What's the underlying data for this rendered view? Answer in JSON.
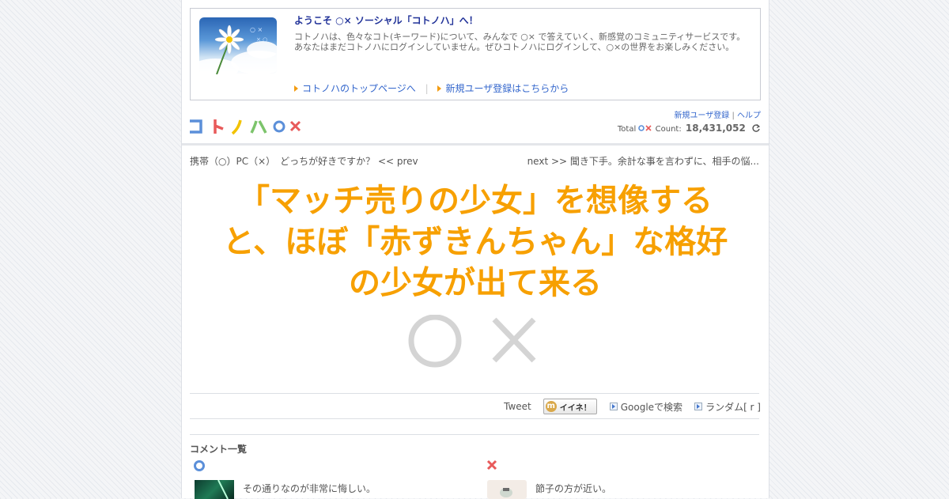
{
  "welcome": {
    "title": "ようこそ ○× ソーシャル「コトノハ」へ！",
    "desc_line1": "コトノハは、色々なコト(キーワード)について、みんなで ○× で答えていく、新感覚のコミュニティサービスです。",
    "desc_line2": "あなたはまだコトノハにログインしていません。ぜひコトノハにログインして、○×の世界をお楽しみください。",
    "link_top": "コトノハのトップページへ",
    "link_register": "新規ユーザ登録はこちらから"
  },
  "header": {
    "logo_letters": [
      "コ",
      "ト",
      "ノ",
      "ハ"
    ],
    "register_link": "新規ユーザ登録",
    "separator": "|",
    "help_link": "ヘルプ",
    "total_label": "Total",
    "count_label": "Count:",
    "count_value": "18,431,052"
  },
  "nav": {
    "prev": "携帯（○）PC（×）　どっちが好きですか？ << prev",
    "next": "next >> 聞き下手。余計な事を言わずに、相手の悩..."
  },
  "headline": {
    "line1": "「マッチ売りの少女」を想像する",
    "line2": "と、ほぼ「赤ずきんちゃん」な格好",
    "line3": "の少女が出て来る"
  },
  "share": {
    "tweet": "Tweet",
    "iine": "イイネ！",
    "google": "Googleで検索",
    "random": "ランダム[ r ]"
  },
  "comments": {
    "title": "コメント一覧",
    "o_text": "その通りなのが非常に悔しい。",
    "x_text": "節子の方が近い。"
  },
  "colors": {
    "accent_orange": "#f7a000",
    "link_blue": "#3366cc",
    "o_blue": "#5b8fd9",
    "x_red": "#e85a5a"
  }
}
